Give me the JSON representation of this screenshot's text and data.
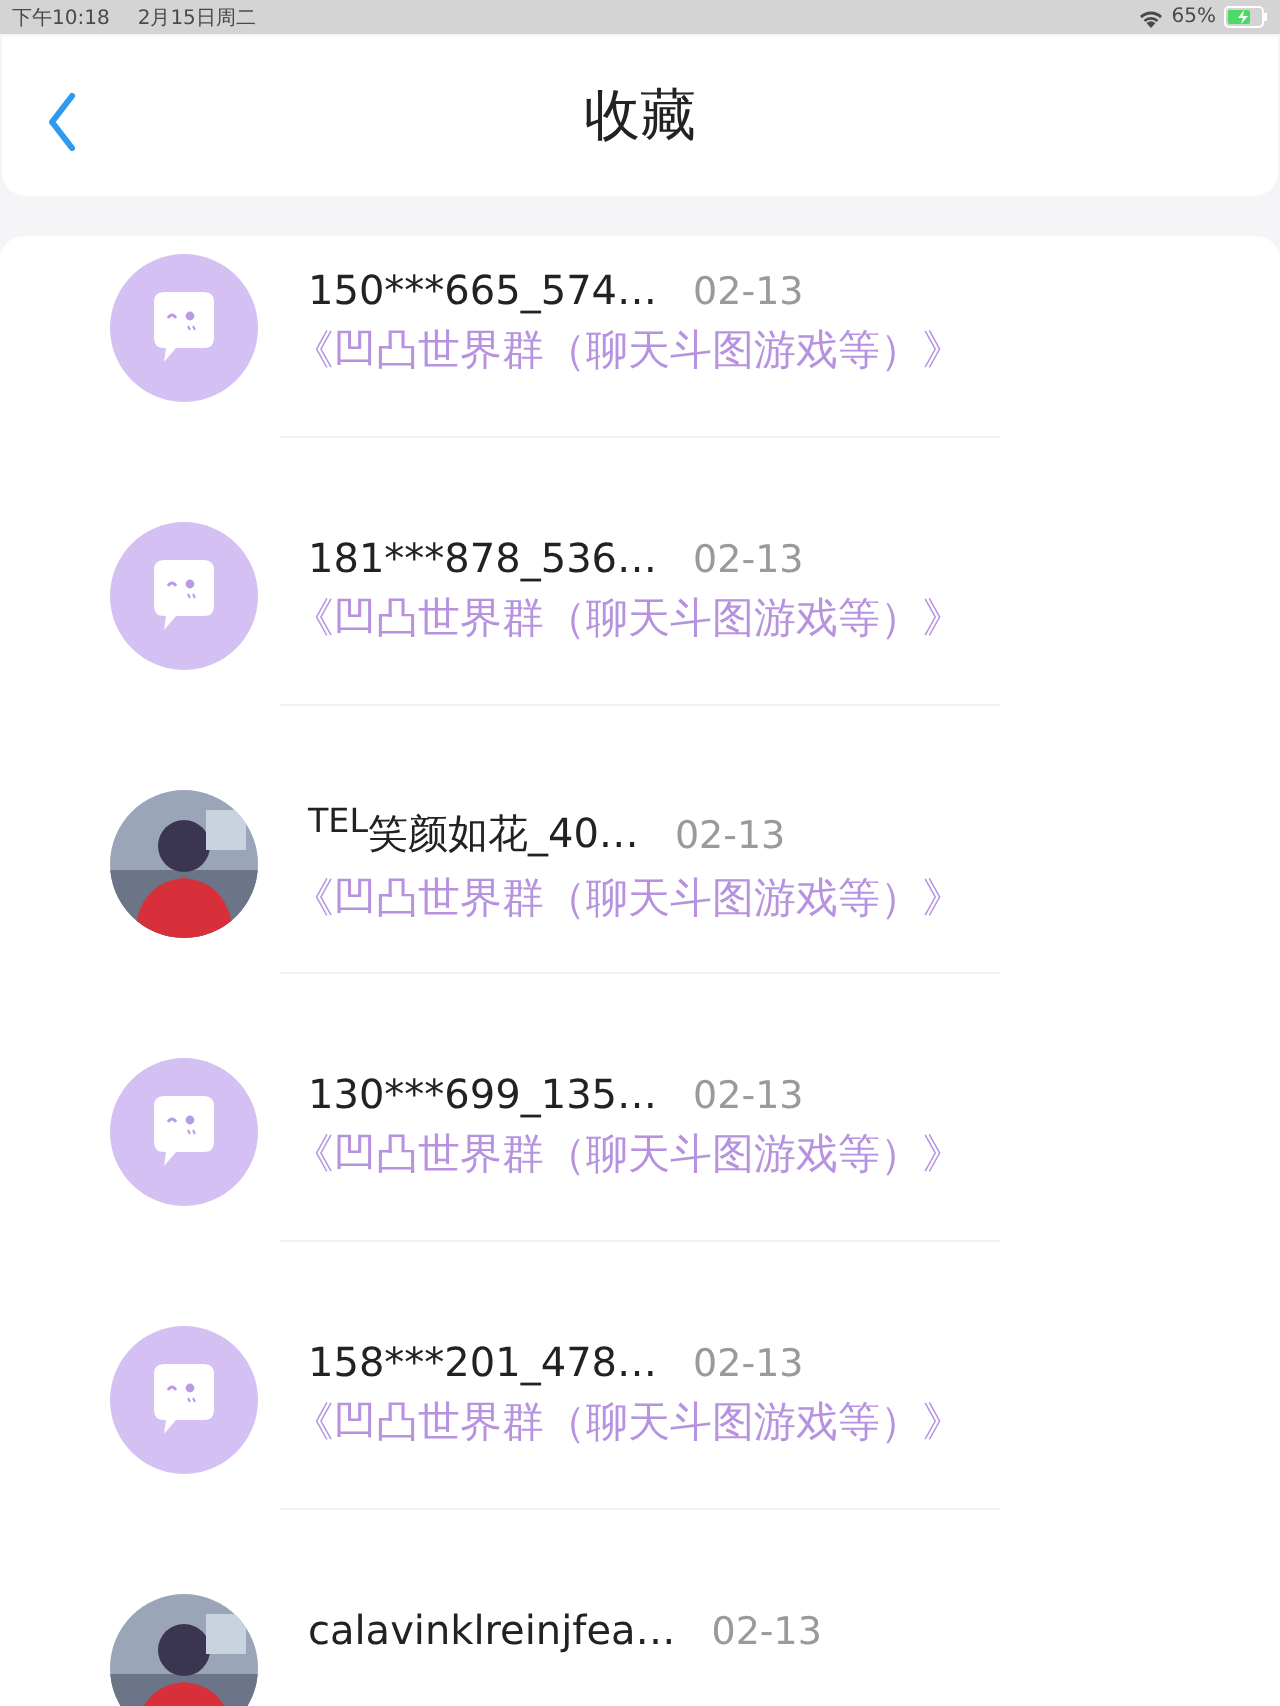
{
  "status_bar": {
    "time": "下午10:18",
    "date": "2月15日周二",
    "battery": "65%"
  },
  "header": {
    "title": "收藏"
  },
  "items": [
    {
      "kind": "default",
      "name": "150***665_574…",
      "date": "02-13",
      "group": "《凹凸世界群（聊天斗图游戏等）》"
    },
    {
      "kind": "default",
      "name": "181***878_536…",
      "date": "02-13",
      "group": "《凹凸世界群（聊天斗图游戏等）》"
    },
    {
      "kind": "picture",
      "name": "$^{TEL}$笑颜如花_40…",
      "date": "02-13",
      "group": "《凹凸世界群（聊天斗图游戏等）》"
    },
    {
      "kind": "default",
      "name": "130***699_135…",
      "date": "02-13",
      "group": "《凹凸世界群（聊天斗图游戏等）》"
    },
    {
      "kind": "default",
      "name": "158***201_478…",
      "date": "02-13",
      "group": "《凹凸世界群（聊天斗图游戏等）》"
    },
    {
      "kind": "picture",
      "name": "calavinklreinjfea…",
      "date": "02-13"
    }
  ]
}
